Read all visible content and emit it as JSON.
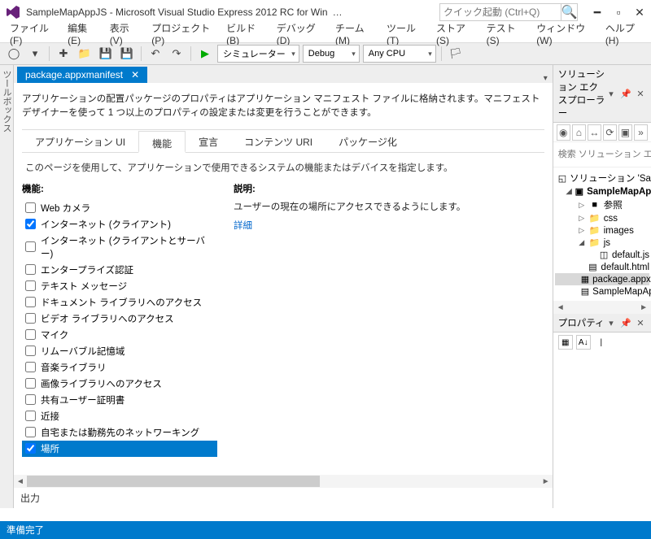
{
  "titlebar": {
    "title": "SampleMapAppJS - Microsoft Visual Studio Express 2012 RC for Win",
    "ellipsis": "…",
    "quicklaunch_placeholder": "クイック起動 (Ctrl+Q)"
  },
  "menubar": [
    "ファイル(F)",
    "編集(E)",
    "表示(V)",
    "プロジェクト(P)",
    "ビルド(B)",
    "デバッグ(D)",
    "チーム(M)",
    "ツール(T)",
    "ストア(S)",
    "テスト(S)",
    "ウィンドウ(W)",
    "ヘルプ(H)"
  ],
  "toolbar": {
    "run_label": "シミュレーター",
    "config": "Debug",
    "platform": "Any CPU"
  },
  "left_tab_label": "ツールボックス",
  "doc_tab": {
    "name": "package.appxmanifest"
  },
  "manifest": {
    "intro": "アプリケーションの配置パッケージのプロパティはアプリケーション マニフェスト ファイルに格納されます。マニフェスト デザイナーを使って 1 つ以上のプロパティの設定または変更を行うことができます。",
    "tabs": [
      "アプリケーション UI",
      "機能",
      "宣言",
      "コンテンツ URI",
      "パッケージ化"
    ],
    "active_tab": 1,
    "page_desc": "このページを使用して、アプリケーションで使用できるシステムの機能またはデバイスを指定します。",
    "cap_header": "機能:",
    "desc_header": "説明:",
    "desc_text": "ユーザーの現在の場所にアクセスできるようにします。",
    "more_link": "詳細",
    "capabilities": [
      {
        "label": "Web カメラ",
        "checked": false,
        "selected": false
      },
      {
        "label": "インターネット (クライアント)",
        "checked": true,
        "selected": false
      },
      {
        "label": "インターネット (クライアントとサーバー)",
        "checked": false,
        "selected": false
      },
      {
        "label": "エンタープライズ認証",
        "checked": false,
        "selected": false
      },
      {
        "label": "テキスト メッセージ",
        "checked": false,
        "selected": false
      },
      {
        "label": "ドキュメント ライブラリへのアクセス",
        "checked": false,
        "selected": false
      },
      {
        "label": "ビデオ ライブラリへのアクセス",
        "checked": false,
        "selected": false
      },
      {
        "label": "マイク",
        "checked": false,
        "selected": false
      },
      {
        "label": "リムーバブル記憶域",
        "checked": false,
        "selected": false
      },
      {
        "label": "音楽ライブラリ",
        "checked": false,
        "selected": false
      },
      {
        "label": "画像ライブラリへのアクセス",
        "checked": false,
        "selected": false
      },
      {
        "label": "共有ユーザー証明書",
        "checked": false,
        "selected": false
      },
      {
        "label": "近接",
        "checked": false,
        "selected": false
      },
      {
        "label": "自宅または勤務先のネットワーキング",
        "checked": false,
        "selected": false
      },
      {
        "label": "場所",
        "checked": true,
        "selected": true
      }
    ]
  },
  "output_label": "出力",
  "solution_explorer": {
    "title": "ソリューション エクスプローラー",
    "search_placeholder": "検索 ソリューション エクスプローラー (",
    "tree": [
      {
        "level": 0,
        "twisty": "",
        "icon": "◱",
        "label": "ソリューション 'SampleMapAppJS' (",
        "bold": false,
        "sel": false
      },
      {
        "level": 1,
        "twisty": "◢",
        "icon": "▣",
        "label": "SampleMapAppJS",
        "bold": true,
        "sel": false
      },
      {
        "level": 2,
        "twisty": "▷",
        "icon": "■",
        "label": "参照",
        "bold": false,
        "sel": false
      },
      {
        "level": 2,
        "twisty": "▷",
        "icon": "📁",
        "label": "css",
        "bold": false,
        "sel": false
      },
      {
        "level": 2,
        "twisty": "▷",
        "icon": "📁",
        "label": "images",
        "bold": false,
        "sel": false
      },
      {
        "level": 2,
        "twisty": "◢",
        "icon": "📁",
        "label": "js",
        "bold": false,
        "sel": false
      },
      {
        "level": 3,
        "twisty": "",
        "icon": "◫",
        "label": "default.js",
        "bold": false,
        "sel": false
      },
      {
        "level": 2,
        "twisty": "",
        "icon": "▤",
        "label": "default.html",
        "bold": false,
        "sel": false
      },
      {
        "level": 2,
        "twisty": "",
        "icon": "▦",
        "label": "package.appxmanifest",
        "bold": false,
        "sel": true
      },
      {
        "level": 2,
        "twisty": "",
        "icon": "▤",
        "label": "SampleMapAppJS_Tempo",
        "bold": false,
        "sel": false
      }
    ]
  },
  "properties": {
    "title": "プロパティ"
  },
  "statusbar": {
    "text": "準備完了"
  }
}
